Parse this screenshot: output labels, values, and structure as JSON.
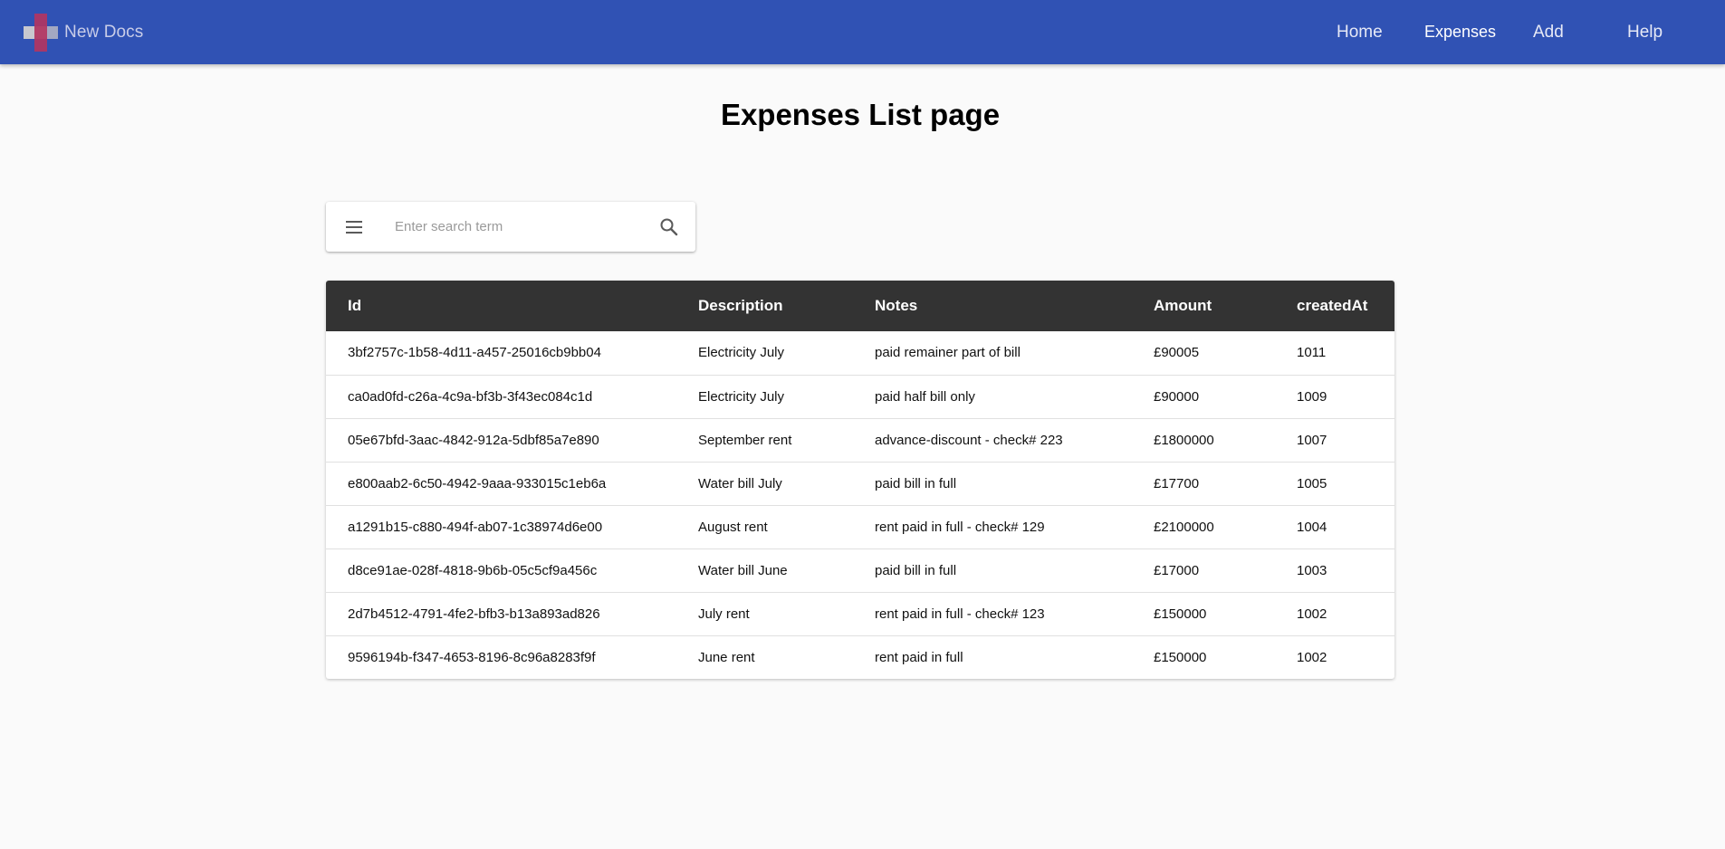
{
  "header": {
    "brand": "New Docs",
    "nav": {
      "home": "Home",
      "expenses": "Expenses",
      "add": "Add",
      "help": "Help"
    },
    "color": "#3052b4"
  },
  "page": {
    "title": "Expenses List page"
  },
  "search": {
    "placeholder": "Enter search term",
    "value": ""
  },
  "table": {
    "columns": [
      "Id",
      "Description",
      "Notes",
      "Amount",
      "createdAt"
    ],
    "rows": [
      [
        "3bf2757c-1b58-4d11-a457-25016cb9bb04",
        "Electricity July",
        "paid remainer part of bill",
        "£90005",
        "1011"
      ],
      [
        "ca0ad0fd-c26a-4c9a-bf3b-3f43ec084c1d",
        "Electricity July",
        "paid half bill only",
        "£90000",
        "1009"
      ],
      [
        "05e67bfd-3aac-4842-912a-5dbf85a7e890",
        "September rent",
        "advance-discount - check# 223",
        "£1800000",
        "1007"
      ],
      [
        "e800aab2-6c50-4942-9aaa-933015c1eb6a",
        "Water bill July",
        "paid bill in full",
        "£17700",
        "1005"
      ],
      [
        "a1291b15-c880-494f-ab07-1c38974d6e00",
        "August rent",
        "rent paid in full - check# 129",
        "£2100000",
        "1004"
      ],
      [
        "d8ce91ae-028f-4818-9b6b-05c5cf9a456c",
        "Water bill June",
        "paid bill in full",
        "£17000",
        "1003"
      ],
      [
        "2d7b4512-4791-4fe2-bfb3-b13a893ad826",
        "July rent",
        "rent paid in full - check# 123",
        "£150000",
        "1002"
      ],
      [
        "9596194b-f347-4653-8196-8c96a8283f9f",
        "June rent",
        "rent paid in full",
        "£150000",
        "1002"
      ]
    ]
  },
  "icons": {
    "menu": "menu-icon",
    "search": "search-icon",
    "logo": "logo-icon"
  }
}
